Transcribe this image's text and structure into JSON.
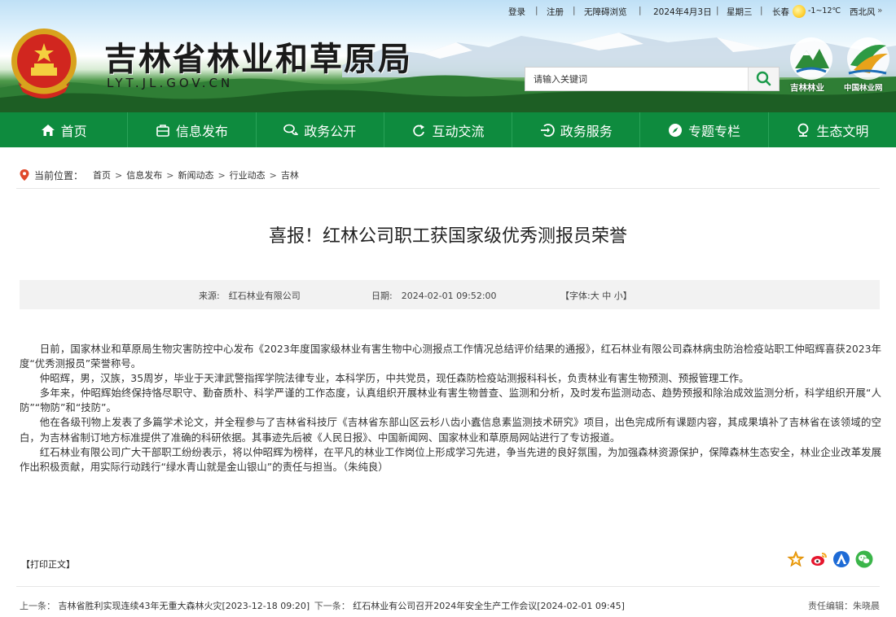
{
  "topbar": {
    "login": "登录",
    "register": "注册",
    "accessible": "无障碍浏览",
    "date": "2024年4月3日",
    "weekday": "星期三",
    "city": "长春",
    "temp": "-1~12℃",
    "wind": "西北风"
  },
  "site": {
    "title": "吉林省林业和草原局",
    "url": "LYT.JL.GOV.CN",
    "logo1_label": "吉林林业",
    "logo2_label": "中国林业网"
  },
  "search": {
    "placeholder": "请输入关键词"
  },
  "nav": {
    "items": [
      "首页",
      "信息发布",
      "政务公开",
      "互动交流",
      "政务服务",
      "专题专栏",
      "生态文明"
    ]
  },
  "breadcrumb": {
    "label": "当前位置：",
    "items": [
      "首页",
      "信息发布",
      "新闻动态",
      "行业动态",
      "吉林"
    ]
  },
  "article": {
    "title": "喜报！红林公司职工获国家级优秀测报员荣誉",
    "source": "来源:　红石林业有限公司",
    "date": "日期:　2024-02-01 09:52:00",
    "font": "【字体:大 中 小】",
    "paragraphs": [
      "日前，国家林业和草原局生物灾害防控中心发布《2023年度国家级林业有害生物中心测报点工作情况总结评价结果的通报》，红石林业有限公司森林病虫防治检疫站职工仲昭辉喜获2023年度“优秀测报员”荣誉称号。",
      "仲昭辉，男，汉族，35周岁，毕业于天津武警指挥学院法律专业，本科学历，中共党员，现任森防检疫站测报科科长，负责林业有害生物预测、预报管理工作。",
      "多年来，仲昭辉始终保持恪尽职守、勤奋质朴、科学严谨的工作态度，认真组织开展林业有害生物普查、监测和分析，及时发布监测动态、趋势预报和除治成效监测分析，科学组织开展“人防”“物防”和“技防”。",
      "他在各级刊物上发表了多篇学术论文，并全程参与了吉林省科技厅《吉林省东部山区云杉八齿小蠹信息素监测技术研究》项目，出色完成所有课题内容，其成果填补了吉林省在该领域的空白，为吉林省制订地方标准提供了准确的科研依据。其事迹先后被《人民日报》、中国新闻网、国家林业和草原局网站进行了专访报道。",
      "红石林业有限公司广大干部职工纷纷表示，将以仲昭辉为榜样，在平凡的林业工作岗位上形成学习先进，争当先进的良好氛围，为加强森林资源保护，保障森林生态安全，林业企业改革发展作出积极贡献，用实际行动践行“绿水青山就是金山银山”的责任与担当。（朱纯良）"
    ]
  },
  "footer": {
    "print": "【打印正文】",
    "prev_label": "上一条：",
    "prev_title": "吉林省胜利实现连续43年无重大森林火灾[2023-12-18 09:20]",
    "next_label": "下一条：",
    "next_title": "红石林业有公司召开2024年安全生产工作会议[2024-02-01 09:45]",
    "editor": "责任编辑：朱晓晨"
  }
}
